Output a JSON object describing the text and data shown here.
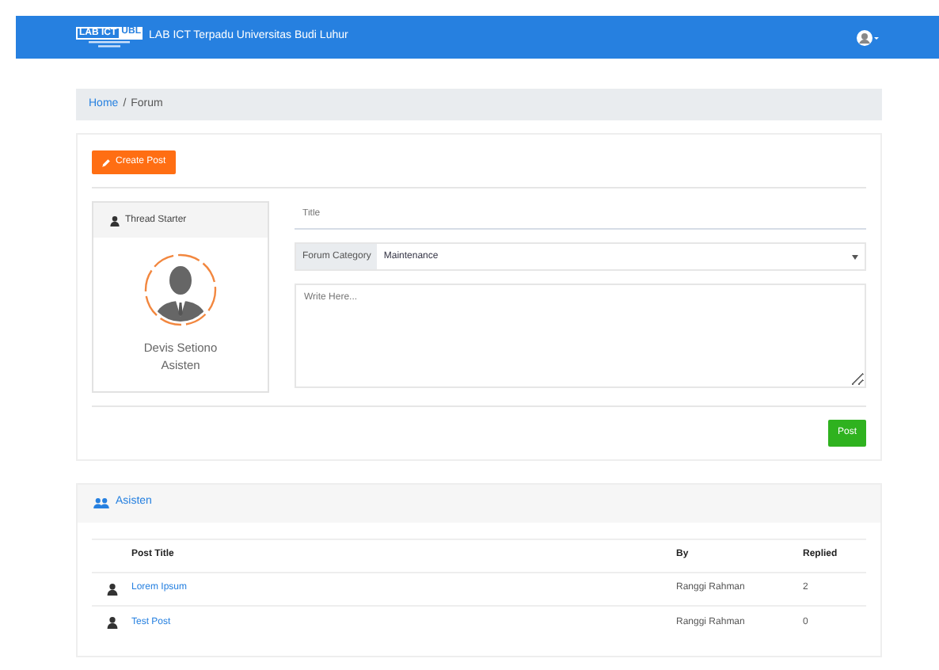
{
  "navbar": {
    "logo_text": "LAB ICT",
    "logo_badge": "UBL",
    "title": "LAB ICT Terpadu Universitas Budi Luhur"
  },
  "breadcrumb": [
    {
      "label": "Home",
      "kind": "link"
    },
    {
      "label": "/",
      "kind": "separator"
    },
    {
      "label": "Forum",
      "kind": "current"
    }
  ],
  "create_button": "Create Post",
  "thread_starter": {
    "heading": "Thread Starter",
    "name": "Devis Setiono",
    "role": "Asisten"
  },
  "form": {
    "title_placeholder": "Title",
    "category_label": "Forum Category",
    "category_value": "Maintenance",
    "body_placeholder": "Write Here...",
    "submit": "Post"
  },
  "threads": {
    "heading": "Asisten",
    "columns": [
      "Post Title",
      "By",
      "Replied"
    ],
    "rows": [
      {
        "title": "Lorem Ipsum",
        "by": "Ranggi Rahman",
        "replied": "2"
      },
      {
        "title": "Test Post",
        "by": "Ranggi Rahman",
        "replied": "0"
      }
    ]
  }
}
